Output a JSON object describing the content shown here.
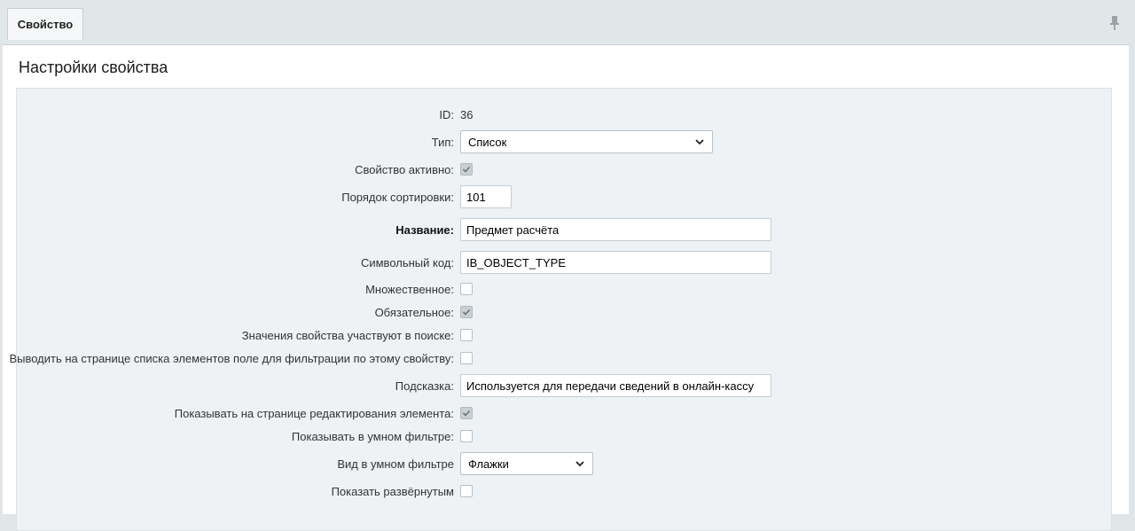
{
  "tabs": [
    {
      "label": "Свойство"
    }
  ],
  "panel": {
    "title": "Настройки свойства"
  },
  "form": {
    "id": {
      "label": "ID:",
      "value": "36"
    },
    "type": {
      "label": "Тип:",
      "value": "Список"
    },
    "active": {
      "label": "Свойство активно:",
      "checked": true
    },
    "sort": {
      "label": "Порядок сортировки:",
      "value": "101"
    },
    "name": {
      "label": "Название:",
      "value": "Предмет расчёта"
    },
    "code": {
      "label": "Символьный код:",
      "value": "IB_OBJECT_TYPE"
    },
    "multiple": {
      "label": "Множественное:",
      "checked": false
    },
    "required": {
      "label": "Обязательное:",
      "checked": true
    },
    "searchable": {
      "label": "Значения свойства участвуют в поиске:",
      "checked": false
    },
    "filtrable": {
      "label": "Выводить на странице списка элементов поле для фильтрации по этому свойству:",
      "checked": false
    },
    "hint": {
      "label": "Подсказка:",
      "value": "Используется для передачи сведений в онлайн-кассу"
    },
    "show_on_edit": {
      "label": "Показывать на странице редактирования элемента:",
      "checked": true
    },
    "smart_filter": {
      "label": "Показывать в умном фильтре:",
      "checked": false
    },
    "smart_filter_view": {
      "label": "Вид в умном фильтре",
      "value": "Флажки"
    },
    "expanded": {
      "label": "Показать развёрнутым",
      "checked": false
    }
  },
  "icons": {
    "pin": "pin-icon",
    "chevron": "chevron-down-icon",
    "check": "check-icon"
  },
  "colors": {
    "background": "#e0e6e8",
    "panel": "#ffffff",
    "content": "#eef2f4"
  }
}
